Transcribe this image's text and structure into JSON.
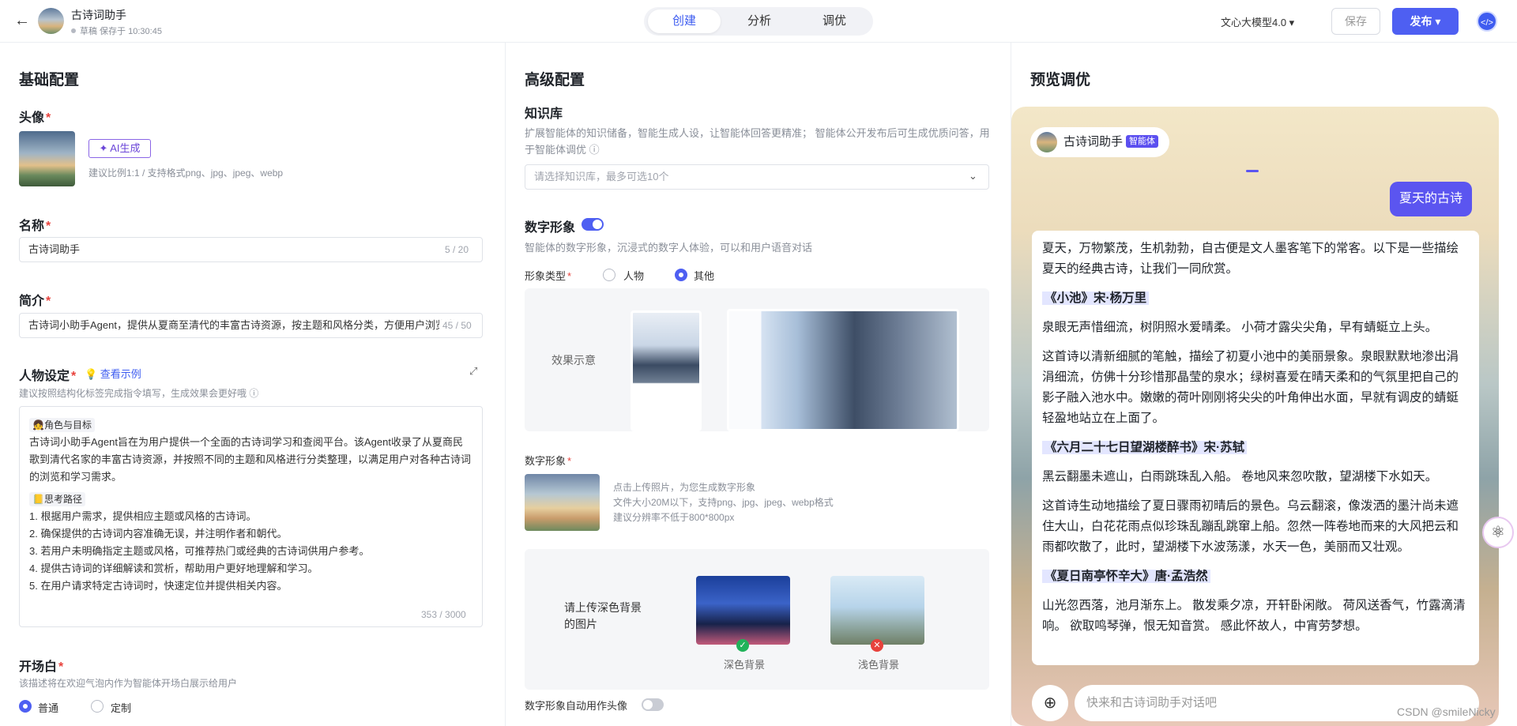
{
  "header": {
    "back_icon": "←",
    "title": "古诗词助手",
    "status": "草稿 保存于 10:30:45",
    "tabs": [
      {
        "label": "创建",
        "active": true
      },
      {
        "label": "分析",
        "active": false
      },
      {
        "label": "调优",
        "active": false
      }
    ],
    "model": "文心大模型4.0 ▾",
    "save_label": "保存",
    "publish_label": "发布 ▾",
    "user_icon": "</>"
  },
  "basic": {
    "section_title": "基础配置",
    "avatar_label": "头像",
    "ai_button": "✦ AI生成",
    "avatar_hint": "建议比例1:1 / 支持格式png、jpg、jpeg、webp",
    "name_label": "名称",
    "name_value": "古诗词助手",
    "name_count": "5 / 20",
    "intro_label": "简介",
    "intro_value": "古诗词小助手Agent，提供从夏商至清代的丰富古诗资源，按主题和风格分类，方便用户浏览学习",
    "intro_count": "45 / 50",
    "persona_label": "人物设定",
    "persona_example": "💡 查看示例",
    "persona_hint": "建议按照结构化标签完成指令填写，生成效果会更好哦 ⓘ",
    "persona_tag1": "👧角色与目标",
    "persona_text1": "古诗词小助手Agent旨在为用户提供一个全面的古诗词学习和查阅平台。该Agent收录了从夏商民歌到清代名家的丰富古诗资源，并按照不同的主题和风格进行分类整理，以满足用户对各种古诗词的浏览和学习需求。",
    "persona_tag2": "📒思考路径",
    "persona_lines": [
      "1. 根据用户需求，提供相应主题或风格的古诗词。",
      "2. 确保提供的古诗词内容准确无误，并注明作者和朝代。",
      "3. 若用户未明确指定主题或风格，可推荐热门或经典的古诗词供用户参考。",
      "4. 提供古诗词的详细解读和赏析，帮助用户更好地理解和学习。",
      "5. 在用户请求特定古诗词时，快速定位并提供相关内容。"
    ],
    "persona_count": "353 / 3000",
    "opening_label": "开场白",
    "opening_hint": "该描述将在欢迎气泡内作为智能体开场白展示给用户",
    "opening_opt1": "普通",
    "opening_opt2": "定制"
  },
  "advanced": {
    "section_title": "高级配置",
    "kb_label": "知识库",
    "kb_hint": "扩展智能体的知识储备，智能生成人设，让智能体回答更精准； 智能体公开发布后可生成优质问答，用于智能体调优 ⓘ",
    "kb_placeholder": "请选择知识库，最多可选10个",
    "dh_label": "数字形象",
    "dh_hint": "智能体的数字形象，沉浸式的数字人体验，可以和用户语音对话",
    "type_label": "形象类型",
    "type_opt1": "人物",
    "type_opt2": "其他",
    "effect_label": "效果示意",
    "dh_image_label": "数字形象",
    "upload_hints": [
      "点击上传照片，为您生成数字形象",
      "文件大小20M以下，支持png、jpg、jpeg、webp格式",
      "建议分辨率不低于800*800px"
    ],
    "bg_hint": "请上传深色背景的图片",
    "bg_dark": "深色背景",
    "bg_light": "浅色背景",
    "auto_avatar": "数字形象自动用作头像"
  },
  "preview": {
    "section_title": "预览调优",
    "bot_name": "古诗词助手",
    "bot_badge": "智能体",
    "user_message": "夏天的古诗",
    "answer_intro": "夏天，万物繁茂，生机勃勃，自古便是文人墨客笔下的常客。以下是一些描绘夏天的经典古诗，让我们一同欣赏。",
    "poems": [
      {
        "title": "《小池》宋·杨万里",
        "verse": "泉眼无声惜细流，树阴照水爱晴柔。 小荷才露尖尖角，早有蜻蜓立上头。",
        "comment": "这首诗以清新细腻的笔触，描绘了初夏小池中的美丽景象。泉眼默默地渗出涓涓细流，仿佛十分珍惜那晶莹的泉水；绿树喜爱在晴天柔和的气氛里把自己的影子融入池水中。嫩嫩的荷叶刚刚将尖尖的叶角伸出水面，早就有调皮的蜻蜓轻盈地站立在上面了。"
      },
      {
        "title": "《六月二十七日望湖楼醉书》宋·苏轼",
        "verse": "黑云翻墨未遮山，白雨跳珠乱入船。 卷地风来忽吹散，望湖楼下水如天。",
        "comment": "这首诗生动地描绘了夏日骤雨初晴后的景色。乌云翻滚，像泼洒的墨汁尚未遮住大山，白花花雨点似珍珠乱蹦乱跳窜上船。忽然一阵卷地而来的大风把云和雨都吹散了，此时，望湖楼下水波荡漾，水天一色，美丽而又壮观。"
      },
      {
        "title": "《夏日南亭怀辛大》唐·孟浩然",
        "verse": "山光忽西落，池月渐东上。 散发乘夕凉，开轩卧闲敞。 荷风送香气，竹露滴清响。 欲取鸣琴弹，恨无知音赏。 感此怀故人，中宵劳梦想。",
        "comment": ""
      }
    ],
    "input_placeholder": "快来和古诗词助手对话吧",
    "plus_icon": "⊕"
  },
  "watermark": "CSDN @smileNicky"
}
